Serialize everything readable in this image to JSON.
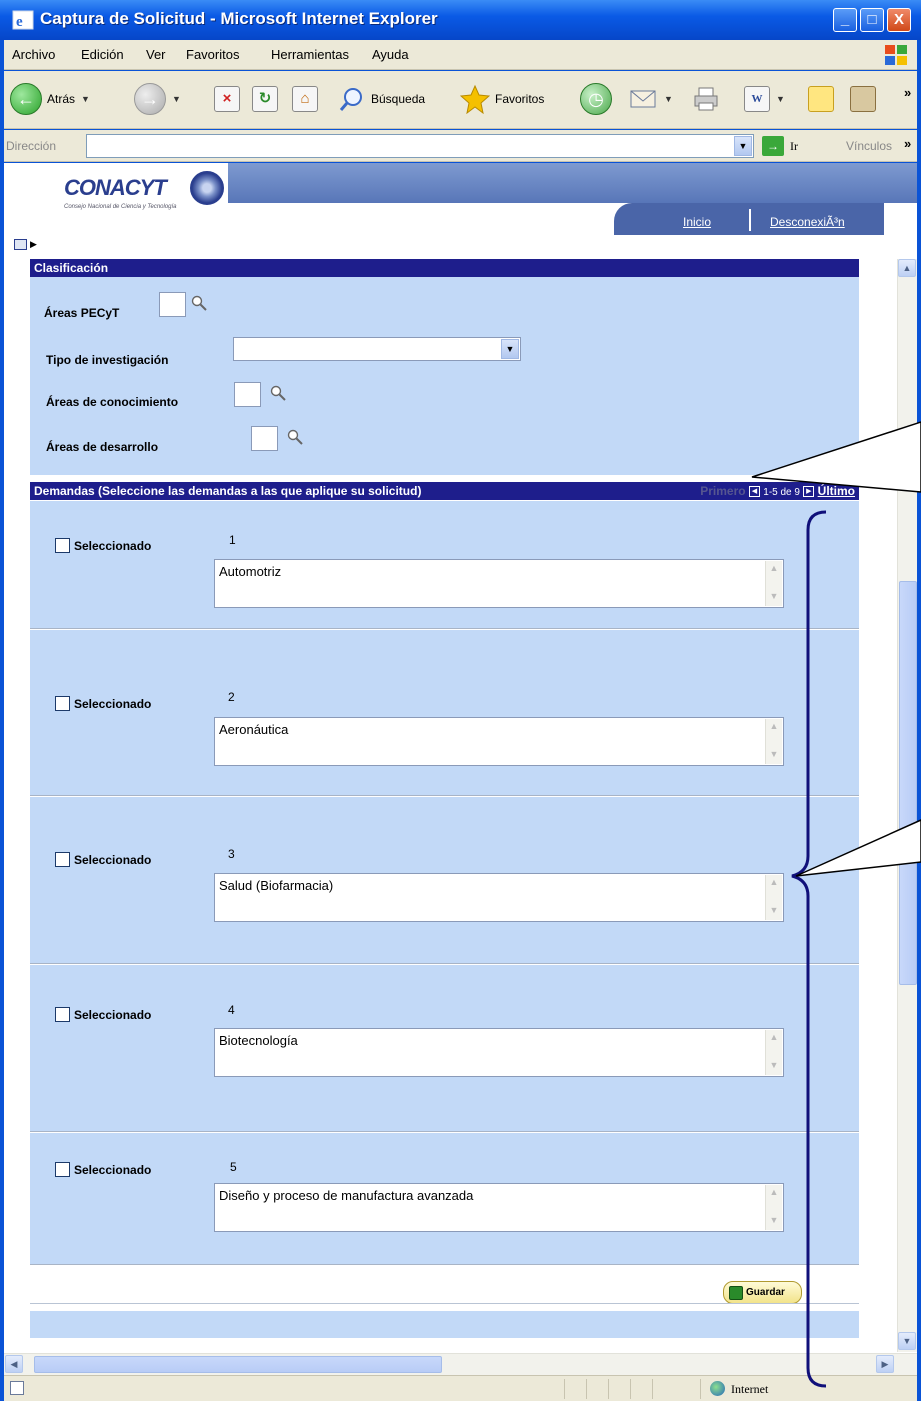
{
  "window": {
    "title": "Captura de Solicitud - Microsoft Internet Explorer",
    "buttons": [
      "_",
      "□",
      "X"
    ]
  },
  "menu": [
    "Archivo",
    "Edición",
    "Ver",
    "Favoritos",
    "Herramientas",
    "Ayuda"
  ],
  "toolbar": {
    "back": "Atrás",
    "search": "Búsqueda",
    "favorites": "Favoritos"
  },
  "addressbar": {
    "label": "Dirección",
    "value": "",
    "go": "Ir",
    "links": "Vínculos"
  },
  "site": {
    "logo": "CONACYT",
    "logo_sub": "Consejo Nacional de Ciencia y Tecnología",
    "nav": [
      "Inicio",
      "DesconexiÃ³n"
    ]
  },
  "clasificacion": {
    "title": "Clasificación",
    "areas_pecyt": "Áreas PECyT",
    "tipo_investigacion": "Tipo de investigación",
    "tipo_investigacion_value": "",
    "areas_conocimiento": "Áreas de conocimiento",
    "areas_desarrollo": "Áreas de desarrollo"
  },
  "demandas": {
    "title": "Demandas (Seleccione las demandas a las que aplique su solicitud)",
    "pager": {
      "first": "Primero",
      "range": "1-5 de 9",
      "last": "Último"
    },
    "checkbox_label": "Seleccionado",
    "rows": [
      {
        "num": "1",
        "text": "Automotriz",
        "checked": false
      },
      {
        "num": "2",
        "text": "Aeronáutica",
        "checked": false
      },
      {
        "num": "3",
        "text": "Salud (Biofarmacia)",
        "checked": false
      },
      {
        "num": "4",
        "text": "Biotecnología",
        "checked": false
      },
      {
        "num": "5",
        "text": "Diseño y proceso de manufactura avanzada",
        "checked": false
      }
    ]
  },
  "save_label": "Guardar",
  "status": {
    "zone": "Internet"
  }
}
